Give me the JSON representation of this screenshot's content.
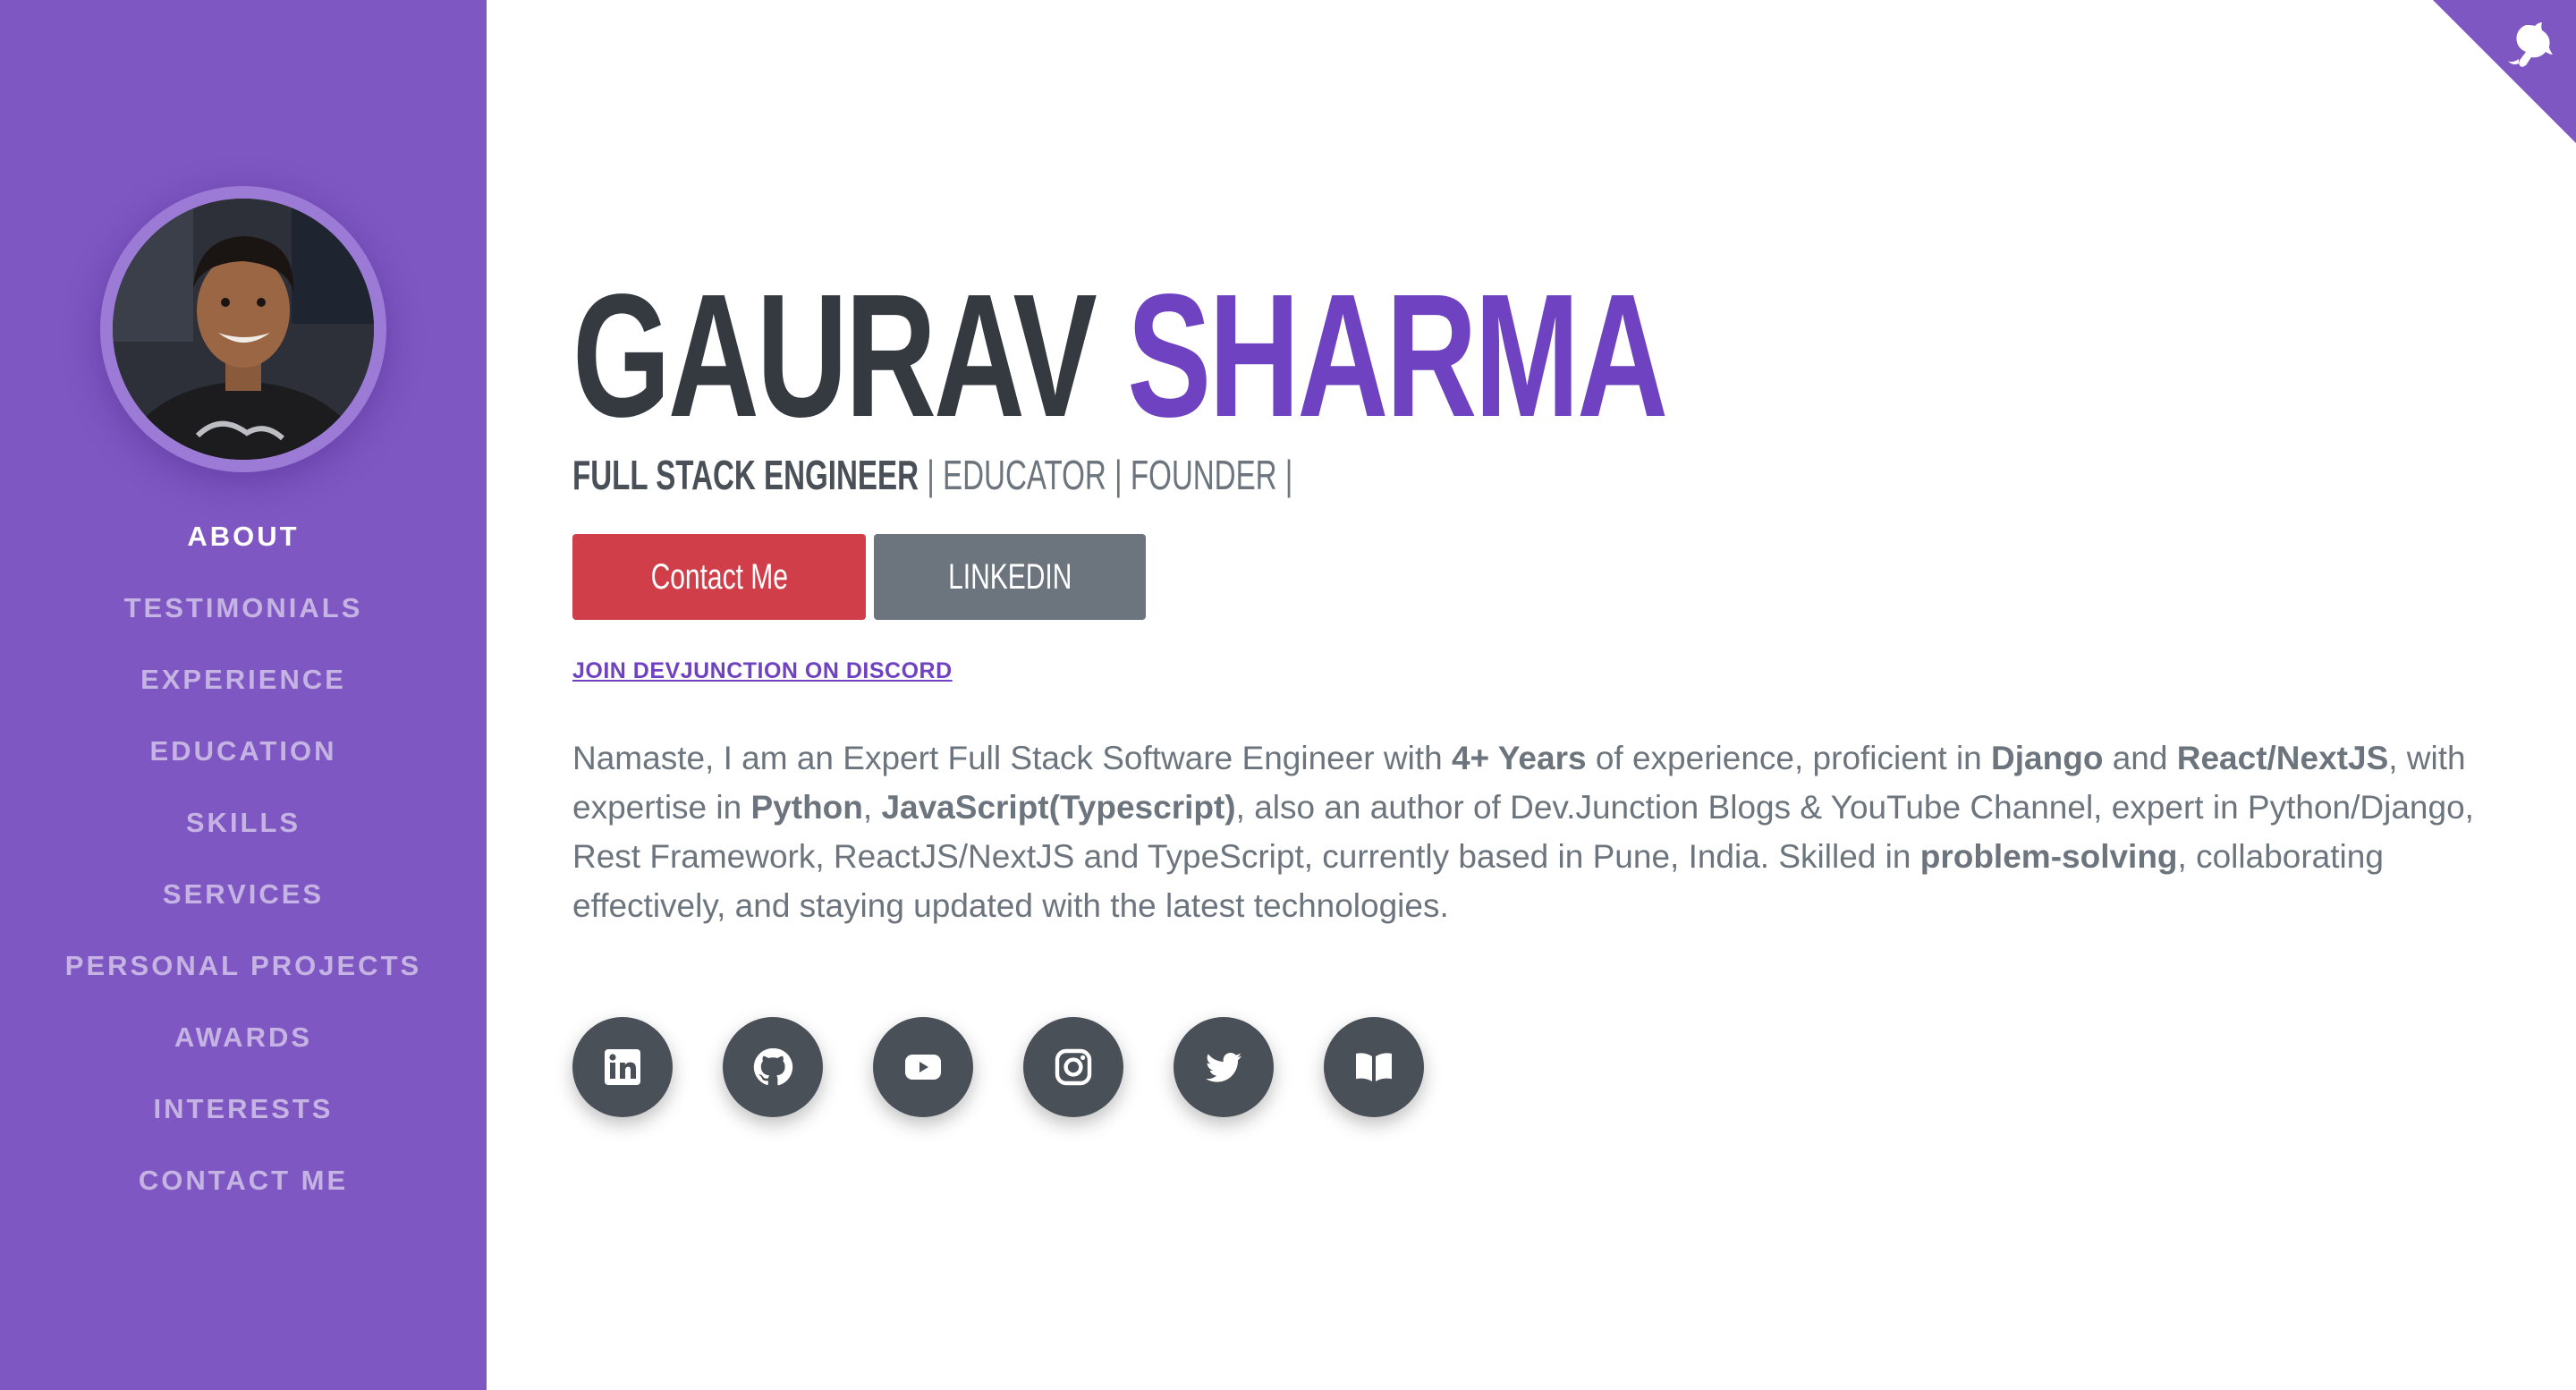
{
  "sidebar": {
    "avatar_alt": "Gaurav Sharma",
    "nav": [
      {
        "label": "About",
        "active": true
      },
      {
        "label": "Testimonials"
      },
      {
        "label": "Experience"
      },
      {
        "label": "Education"
      },
      {
        "label": "Skills"
      },
      {
        "label": "Services"
      },
      {
        "label": "Personal Projects"
      },
      {
        "label": "Awards"
      },
      {
        "label": "Interests"
      },
      {
        "label": "Contact Me"
      }
    ]
  },
  "header": {
    "first_name": "GAURAV",
    "last_name": "SHARMA",
    "subtitle_bold": "FULL STACK ENGINEER",
    "subtitle_rest": " | EDUCATOR | FOUNDER |"
  },
  "buttons": {
    "contact": "Contact Me",
    "linkedin": "LINKEDIN"
  },
  "discord_link": "JOIN DEVJUNCTION ON DISCORD",
  "bio": {
    "p1": "Namaste, I am an Expert Full Stack Software Engineer with ",
    "b1": "4+ Years",
    "p2": " of experience, proficient in ",
    "b2": "Django",
    "p3": " and ",
    "b3": "React/NextJS",
    "p4": ", with expertise in ",
    "b4": "Python",
    "p5": ", ",
    "b5": "JavaScript(Typescript)",
    "p6": ", also an author of Dev.Junction Blogs & YouTube Channel, expert in Python/Django, Rest Framework, ReactJS/NextJS and TypeScript, currently based in Pune, India. Skilled in ",
    "b6": "problem-solving",
    "p7": ", collaborating effectively, and staying updated with the latest technologies."
  },
  "socials": [
    "linkedin-icon",
    "github-icon",
    "youtube-icon",
    "instagram-icon",
    "twitter-icon",
    "book-icon"
  ],
  "colors": {
    "sidebar": "#7e57c2",
    "accent": "#6f42c1",
    "contact_button": "#d03f49",
    "linkedin_button": "#6c757d",
    "social_circle": "#495057"
  }
}
